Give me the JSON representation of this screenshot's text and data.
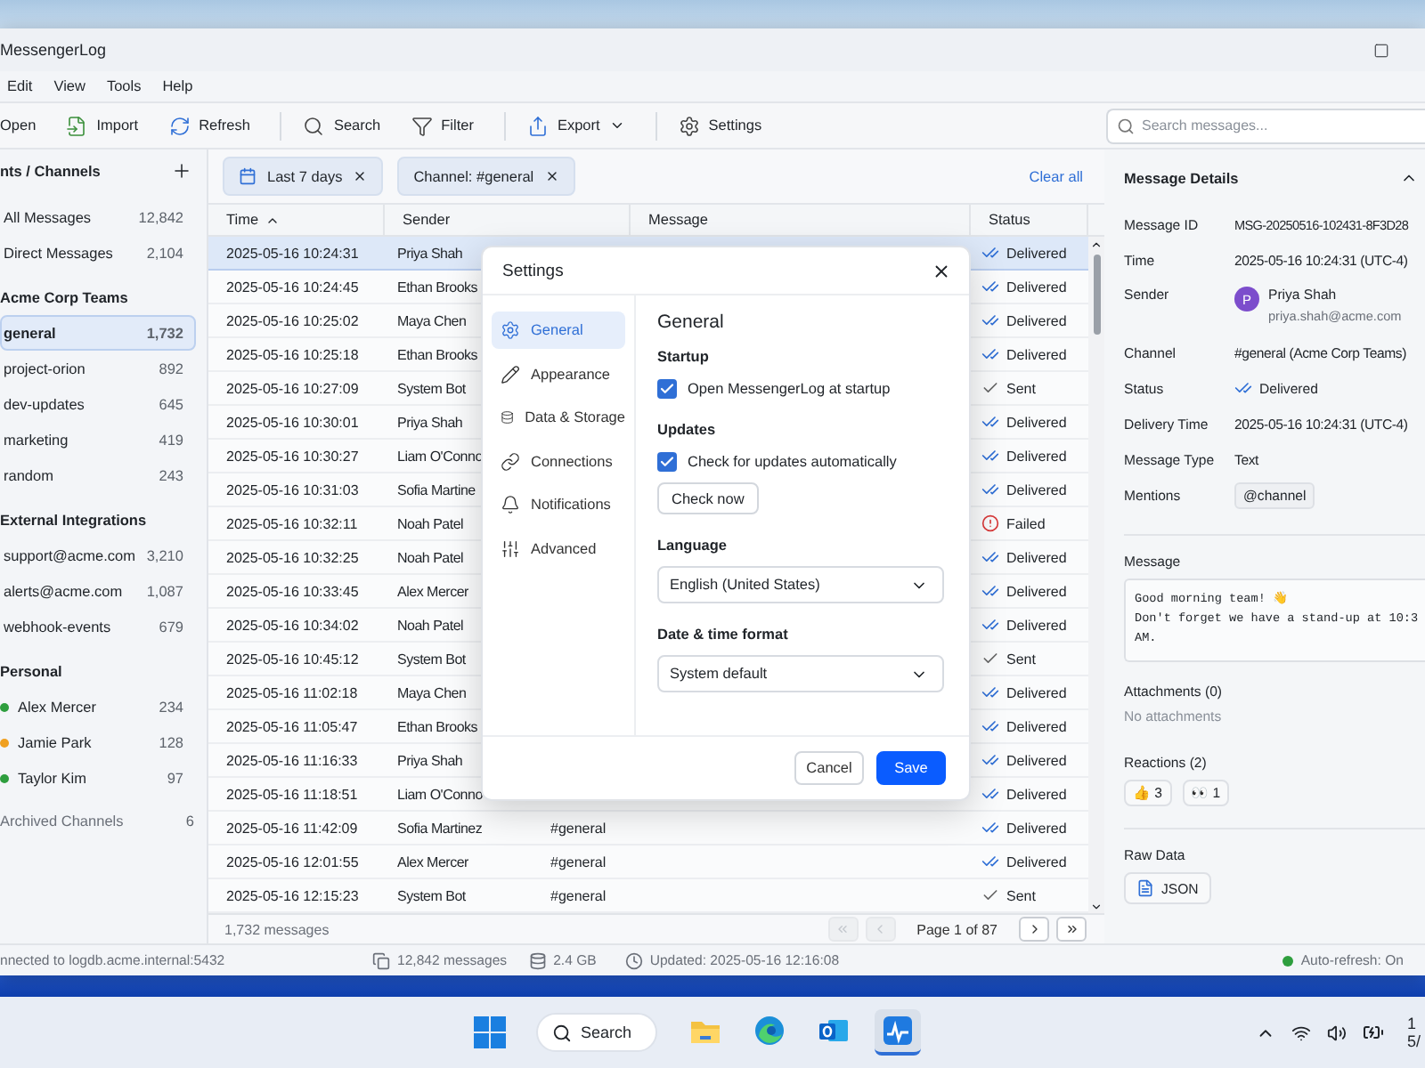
{
  "window": {
    "title": "MessengerLog"
  },
  "menu": [
    "Edit",
    "View",
    "Tools",
    "Help"
  ],
  "toolbar": [
    [
      {
        "label": "Open",
        "kind": "open"
      },
      {
        "label": "Import",
        "kind": "import"
      },
      {
        "label": "Refresh",
        "kind": "refresh"
      }
    ],
    [
      {
        "label": "Search",
        "kind": "search"
      },
      {
        "label": "Filter",
        "kind": "filter"
      }
    ],
    [
      {
        "label": "Export",
        "kind": "export",
        "menu": true
      }
    ],
    [
      {
        "label": "Settings",
        "kind": "settings"
      }
    ]
  ],
  "search": {
    "placeholder": "Search messages..."
  },
  "sidebar": {
    "title": "nts / Channels",
    "groups": [
      {
        "items": [
          {
            "name": "All Messages",
            "count": "12,842",
            "selected": false
          },
          {
            "name": "Direct Messages",
            "count": "2,104",
            "selected": false
          }
        ]
      },
      {
        "title": "Acme Corp Teams",
        "items": [
          {
            "name": "general",
            "count": "1,732",
            "selected": true
          },
          {
            "name": "project-orion",
            "count": "892",
            "selected": false
          },
          {
            "name": "dev-updates",
            "count": "645",
            "selected": false
          },
          {
            "name": "marketing",
            "count": "419",
            "selected": false
          },
          {
            "name": "random",
            "count": "243",
            "selected": false
          }
        ]
      },
      {
        "title": "External Integrations",
        "items": [
          {
            "name": "support@acme.com",
            "count": "3,210",
            "selected": false
          },
          {
            "name": "alerts@acme.com",
            "count": "1,087",
            "selected": false
          },
          {
            "name": "webhook-events",
            "count": "679",
            "selected": false
          }
        ]
      },
      {
        "title": "Personal",
        "items": [
          {
            "name": "Alex Mercer",
            "count": "234",
            "selected": false,
            "color": "#2e9e3e"
          },
          {
            "name": "Jamie Park",
            "count": "128",
            "selected": false,
            "color": "#f0a020"
          },
          {
            "name": "Taylor Kim",
            "count": "97",
            "selected": false,
            "color": "#2e9e3e"
          }
        ]
      }
    ],
    "archived": {
      "label": "Archived Channels",
      "count": "6"
    }
  },
  "filters": [
    {
      "label": "Last 7 days",
      "kind": "date"
    },
    {
      "label": "Channel: #general",
      "kind": "channel"
    }
  ],
  "clear_all": "Clear all",
  "table": {
    "columns": [
      {
        "label": "Time",
        "sorted": true
      },
      {
        "label": "Sender",
        "sorted": false
      },
      {
        "label": "Message",
        "sorted": false
      },
      {
        "label": "Status",
        "sorted": false
      }
    ],
    "rows": [
      {
        "time": "2025-05-16 10:24:31",
        "sender": "Priya Shah",
        "status": {
          "kind": "delivered",
          "label": "Delivered"
        },
        "selected": true
      },
      {
        "time": "2025-05-16 10:24:45",
        "sender": "Ethan Brooks",
        "status": {
          "kind": "delivered",
          "label": "Delivered"
        },
        "selected": false
      },
      {
        "time": "2025-05-16 10:25:02",
        "sender": "Maya Chen",
        "status": {
          "kind": "delivered",
          "label": "Delivered"
        },
        "selected": false
      },
      {
        "time": "2025-05-16 10:25:18",
        "sender": "Ethan Brooks",
        "status": {
          "kind": "delivered",
          "label": "Delivered"
        },
        "selected": false
      },
      {
        "time": "2025-05-16 10:27:09",
        "sender": "System Bot",
        "status": {
          "kind": "sent",
          "label": "Sent"
        },
        "selected": false
      },
      {
        "time": "2025-05-16 10:30:01",
        "sender": "Priya Shah",
        "status": {
          "kind": "delivered",
          "label": "Delivered"
        },
        "selected": false
      },
      {
        "time": "2025-05-16 10:30:27",
        "sender": "Liam O'Conno",
        "status": {
          "kind": "delivered",
          "label": "Delivered"
        },
        "selected": false
      },
      {
        "time": "2025-05-16 10:31:03",
        "sender": "Sofia Martine",
        "status": {
          "kind": "delivered",
          "label": "Delivered"
        },
        "selected": false
      },
      {
        "time": "2025-05-16 10:32:11",
        "sender": "Noah Patel",
        "status": {
          "kind": "failed",
          "label": "Failed"
        },
        "selected": false
      },
      {
        "time": "2025-05-16 10:32:25",
        "sender": "Noah Patel",
        "status": {
          "kind": "delivered",
          "label": "Delivered"
        },
        "selected": false
      },
      {
        "time": "2025-05-16 10:33:45",
        "sender": "Alex Mercer",
        "status": {
          "kind": "delivered",
          "label": "Delivered"
        },
        "selected": false
      },
      {
        "time": "2025-05-16 10:34:02",
        "sender": "Noah Patel",
        "status": {
          "kind": "delivered",
          "label": "Delivered"
        },
        "selected": false
      },
      {
        "time": "2025-05-16 10:45:12",
        "sender": "System Bot",
        "status": {
          "kind": "sent",
          "label": "Sent"
        },
        "selected": false
      },
      {
        "time": "2025-05-16 11:02:18",
        "sender": "Maya Chen",
        "status": {
          "kind": "delivered",
          "label": "Delivered"
        },
        "selected": false
      },
      {
        "time": "2025-05-16 11:05:47",
        "sender": "Ethan Brooks",
        "status": {
          "kind": "delivered",
          "label": "Delivered"
        },
        "selected": false
      },
      {
        "time": "2025-05-16 11:16:33",
        "sender": "Priya Shah",
        "status": {
          "kind": "delivered",
          "label": "Delivered"
        },
        "selected": false
      },
      {
        "time": "2025-05-16 11:18:51",
        "sender": "Liam O'Conno",
        "status": {
          "kind": "delivered",
          "label": "Delivered"
        },
        "selected": false
      },
      {
        "time": "2025-05-16 11:42:09",
        "sender": "Sofia Martinez",
        "channel": "#general",
        "status": {
          "kind": "delivered",
          "label": "Delivered"
        },
        "selected": false
      },
      {
        "time": "2025-05-16 12:01:55",
        "sender": "Alex Mercer",
        "channel": "#general",
        "status": {
          "kind": "delivered",
          "label": "Delivered"
        },
        "selected": false
      },
      {
        "time": "2025-05-16 12:15:23",
        "sender": "System Bot",
        "channel": "#general",
        "status": {
          "kind": "sent",
          "label": "Sent"
        },
        "selected": false
      }
    ]
  },
  "table_footer": {
    "count": "1,732 messages",
    "page": "Page 1 of 87",
    "buttons": [
      {
        "kind": "first",
        "disabled": true
      },
      {
        "kind": "prev",
        "disabled": true
      },
      {
        "kind": "next",
        "disabled": false
      },
      {
        "kind": "last",
        "disabled": false
      }
    ]
  },
  "dialog": {
    "title": "Settings",
    "nav": [
      {
        "label": "General",
        "kind": "general",
        "selected": true
      },
      {
        "label": "Appearance",
        "kind": "appearance",
        "selected": false
      },
      {
        "label": "Data & Storage",
        "kind": "storage",
        "selected": false
      },
      {
        "label": "Connections",
        "kind": "connections",
        "selected": false
      },
      {
        "label": "Notifications",
        "kind": "notifications",
        "selected": false
      },
      {
        "label": "Advanced",
        "kind": "advanced",
        "selected": false
      }
    ],
    "heading": "General",
    "groups": [
      {
        "title": "Startup",
        "items": [
          {
            "kind": "checkbox",
            "label": "Open MessengerLog at startup",
            "checked": true
          }
        ]
      },
      {
        "title": "Updates",
        "items": [
          {
            "kind": "checkbox",
            "label": "Check for updates automatically",
            "checked": true
          },
          {
            "kind": "button",
            "label": "Check now"
          }
        ]
      },
      {
        "title": "Language",
        "items": [
          {
            "kind": "select",
            "value": "English (United States)"
          }
        ]
      },
      {
        "title": "Date & time format",
        "items": [
          {
            "kind": "select",
            "value": "System default"
          }
        ]
      }
    ],
    "buttons": [
      {
        "label": "Cancel",
        "primary": false
      },
      {
        "label": "Save",
        "primary": true
      }
    ]
  },
  "details": {
    "title": "Message Details",
    "fields": [
      {
        "label": "Message ID",
        "kind": "id",
        "value": "MSG-20250516-102431-8F3D28"
      },
      {
        "label": "Time",
        "kind": "text",
        "value": "2025-05-16 10:24:31 (UTC-4)"
      },
      {
        "label": "Sender",
        "kind": "person",
        "initial": "P",
        "value": "Priya Shah",
        "email": "priya.shah@acme.com"
      },
      {
        "label": "Channel",
        "kind": "text",
        "value": "#general (Acme Corp Teams)"
      },
      {
        "label": "Status",
        "kind": "status",
        "value": {
          "kind": "delivered",
          "label": "Delivered"
        }
      },
      {
        "label": "Delivery Time",
        "kind": "text",
        "value": "2025-05-16 10:24:31 (UTC-4)"
      },
      {
        "label": "Message Type",
        "kind": "text",
        "value": "Text"
      },
      {
        "label": "Mentions",
        "kind": "chip",
        "value": "@channel"
      }
    ],
    "message": {
      "title": "Message",
      "body": "Good morning team! 👋\nDon't forget we have a stand-up at 10:3\nAM."
    },
    "attachments": {
      "title": "Attachments (0)",
      "empty": "No attachments"
    },
    "reactions": {
      "title": "Reactions (2)",
      "items": [
        {
          "emoji": "👍",
          "count": "3"
        },
        {
          "emoji": "👀",
          "count": "1"
        }
      ]
    },
    "raw": {
      "title": "Raw Data",
      "button": "JSON"
    }
  },
  "status_bar": {
    "connection": "nnected to logdb.acme.internal:5432",
    "messages": "12,842 messages",
    "size": "2.4 GB",
    "updated": "Updated: 2025-05-16 12:16:08",
    "auto_refresh": "Auto-refresh: On",
    "auto_refresh_on": true
  },
  "taskbar": {
    "search": "Search",
    "apps": [
      {
        "kind": "explorer",
        "selected": false
      },
      {
        "kind": "edge",
        "selected": false
      },
      {
        "kind": "outlook",
        "selected": false
      },
      {
        "kind": "messengerlog",
        "selected": true
      }
    ],
    "clock": [
      "1",
      "5/"
    ]
  }
}
